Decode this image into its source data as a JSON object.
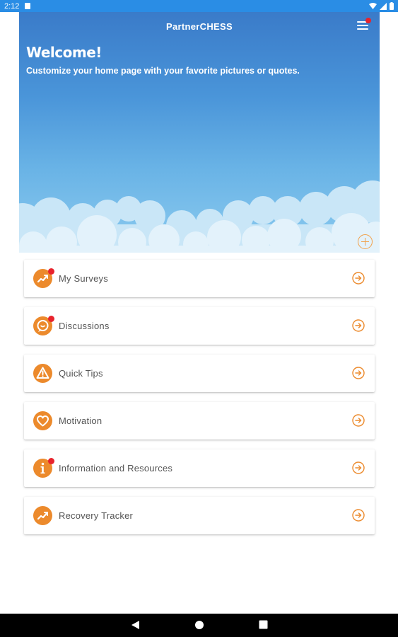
{
  "status_bar": {
    "time": "2:12"
  },
  "header": {
    "app_name": "PartnerCHESS"
  },
  "hero": {
    "title": "Welcome!",
    "subtitle": "Customize your home page with your favorite pictures or quotes."
  },
  "menu": [
    {
      "label": "My Surveys",
      "icon": "chart-trend-icon",
      "has_notification": true
    },
    {
      "label": "Discussions",
      "icon": "chat-bubble-icon",
      "has_notification": true
    },
    {
      "label": "Quick Tips",
      "icon": "warning-triangle-icon",
      "has_notification": false
    },
    {
      "label": "Motivation",
      "icon": "heart-icon",
      "has_notification": false
    },
    {
      "label": "Information and Resources",
      "icon": "info-icon",
      "has_notification": true
    },
    {
      "label": "Recovery Tracker",
      "icon": "chart-trend-icon",
      "has_notification": false
    }
  ],
  "colors": {
    "accent": "#ec8a2c",
    "badge": "#e8232c",
    "status_bar": "#2a8de5",
    "sky_top": "#3a7bc9",
    "sky_bottom": "#8ccbef"
  }
}
